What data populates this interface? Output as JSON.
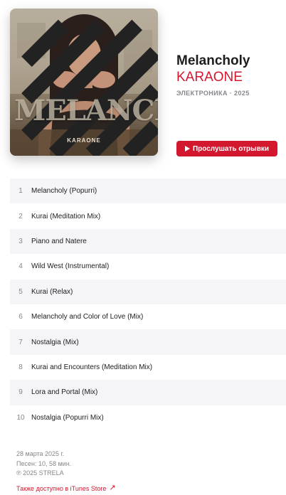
{
  "album": {
    "title": "Melancholy",
    "artist": "KARAONE",
    "meta": "ЭЛЕКТРОНИКА · 2025",
    "cover_title": "MELANCHOLY",
    "cover_artist": "KARAONE",
    "preview_label": "Прослушать отрывки"
  },
  "tracks": [
    {
      "num": "1",
      "name": "Melancholy (Popurri)"
    },
    {
      "num": "2",
      "name": "Kurai (Meditation Mix)"
    },
    {
      "num": "3",
      "name": "Piano and Natere"
    },
    {
      "num": "4",
      "name": "Wild West (Instrumental)"
    },
    {
      "num": "5",
      "name": "Kurai (Relax)"
    },
    {
      "num": "6",
      "name": "Melancholy and Color of Love (Mix)"
    },
    {
      "num": "7",
      "name": "Nostalgia (Mix)"
    },
    {
      "num": "8",
      "name": "Kurai and Encounters (Meditation Mix)"
    },
    {
      "num": "9",
      "name": "Lora and Portal (Mix)"
    },
    {
      "num": "10",
      "name": "Nostalgia (Popurri Mix)"
    }
  ],
  "footer": {
    "release_date": "28 марта 2025 г.",
    "summary": "Песен: 10, 58 мин.",
    "copyright": "℗ 2025 STRELA",
    "itunes_link": "Также доступно в iTunes Store"
  },
  "colors": {
    "accent": "#d3172e",
    "secondary_text": "#86868b",
    "row_alt": "#f5f5f7"
  },
  "icons": {
    "play": "play-icon",
    "external": "arrow-up-right-icon",
    "logo": "label-logo-icon"
  }
}
